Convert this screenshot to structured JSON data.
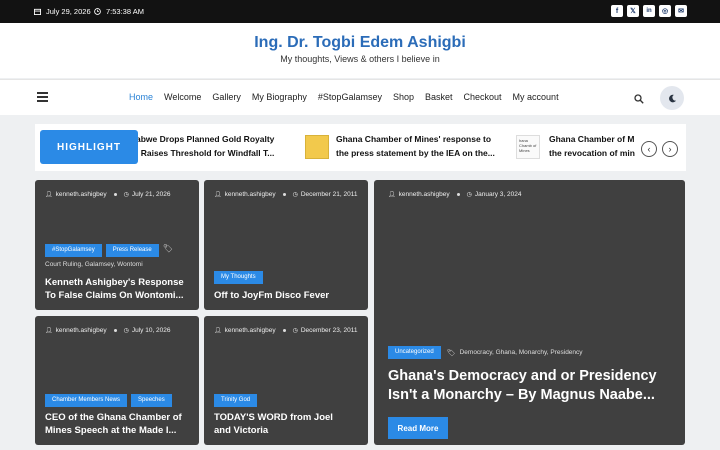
{
  "topbar": {
    "date": "July 29, 2026",
    "time": "7:53:38 AM",
    "date_icon": "calendar-icon",
    "time_icon": "clock-icon",
    "social": [
      {
        "name": "facebook-icon",
        "glyph": "f"
      },
      {
        "name": "x-twitter-icon",
        "glyph": "𝕏"
      },
      {
        "name": "linkedin-icon",
        "glyph": "in"
      },
      {
        "name": "instagram-icon",
        "glyph": "◎"
      },
      {
        "name": "email-icon",
        "glyph": "✉"
      }
    ]
  },
  "header": {
    "title": "Ing. Dr. Togbi Edem Ashigbi",
    "tagline": "My thoughts, Views & others I believe in"
  },
  "nav": {
    "items": [
      "Home",
      "Welcome",
      "Gallery",
      "My Biography",
      "#StopGalamsey",
      "Shop",
      "Basket",
      "Checkout",
      "My account"
    ],
    "active": "Home"
  },
  "ticker": {
    "badge": "HIGHLIGHT",
    "items": [
      {
        "line1": "abwe Drops Planned Gold Royalty",
        "line2": ", Raises Threshold for Windfall T..."
      },
      {
        "line1": "Ghana Chamber of Mines' response to",
        "line2": "the press statement by the IEA on the..."
      },
      {
        "line1": "Ghana Chamber of M",
        "line2": "the revocation of min"
      }
    ],
    "thumb_text": "hana Chamb of Mines",
    "prev": "‹",
    "next": "›"
  },
  "cards": [
    {
      "author": "kenneth.ashigbey",
      "date": "July 21, 2026",
      "tags": [
        "#StopGalamsey",
        "Press Release"
      ],
      "subtags": "Court Ruling,  Galamsey,  Wontomi",
      "title1": "Kenneth Ashigbey's Response",
      "title2": "To False Claims On Wontomi..."
    },
    {
      "author": "kenneth.ashigbey",
      "date": "December 21, 2011",
      "tags": [
        "My Thoughts"
      ],
      "title1": "Off to JoyFm Disco Fever"
    },
    {
      "author": "kenneth.ashigbey",
      "date": "July 10, 2026",
      "tags": [
        "Chamber Members News",
        "Speeches"
      ],
      "title1": "CEO of the Ghana Chamber of",
      "title2": "Mines Speech at the Made I..."
    },
    {
      "author": "kenneth.ashigbey",
      "date": "December 23, 2011",
      "tags": [
        "Trinity God"
      ],
      "title1": "TODAY'S WORD from Joel",
      "title2": "and Victoria"
    }
  ],
  "feature": {
    "author": "kenneth.ashigbey",
    "date": "January 3, 2024",
    "tag": "Uncategorized",
    "subtags": "Democracy,  Ghana,  Monarchy,  Presidency",
    "title1": "Ghana's Democracy and or Presidency",
    "title2": "Isn't a Monarchy – By Magnus Naabe...",
    "read_more": "Read More"
  }
}
